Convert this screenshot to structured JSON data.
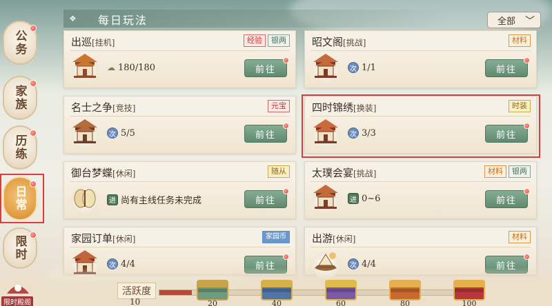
{
  "header": {
    "title": "每日玩法",
    "filter_label": "全部"
  },
  "nav": [
    {
      "label": "公务"
    },
    {
      "label": "家族"
    },
    {
      "label": "历练"
    },
    {
      "label": "日常"
    },
    {
      "label": "限时"
    }
  ],
  "mascot_label": "限时殿阁",
  "cards": [
    {
      "name": "出巡",
      "sub": "[挂机]",
      "tags": [
        "经验",
        "银两"
      ],
      "badge": "☁",
      "value": "180/180",
      "button": "前往"
    },
    {
      "name": "昭文阁",
      "sub": "[挑战]",
      "tags": [
        "材料"
      ],
      "badge": "次",
      "value": "1/1",
      "button": "前往"
    },
    {
      "name": "名士之争",
      "sub": "[竞技]",
      "tags": [
        "元宝"
      ],
      "badge": "次",
      "value": "5/5",
      "button": "前往"
    },
    {
      "name": "四时锦绣",
      "sub": "[换装]",
      "tags": [
        "时装"
      ],
      "badge": "次",
      "value": "3/3",
      "button": "前往"
    },
    {
      "name": "御台梦蝶",
      "sub": "[休闲]",
      "tags": [
        "随从"
      ],
      "badge": "进",
      "value": "尚有主线任务未完成",
      "button": "前往"
    },
    {
      "name": "太璞会宴",
      "sub": "[挑战]",
      "tags": [
        "材料",
        "银两"
      ],
      "badge": "进",
      "value": "0~6",
      "button": "前往"
    },
    {
      "name": "家园订单",
      "sub": "[休闲]",
      "tags": [
        "家园币"
      ],
      "badge": "次",
      "value": "4/4",
      "button": "前往"
    },
    {
      "name": "出游",
      "sub": "[休闲]",
      "tags": [
        "材料"
      ],
      "badge": "次",
      "value": "4/4",
      "button": "前往"
    }
  ],
  "activity": {
    "label": "活跃度",
    "value": "10",
    "progress": 0.1,
    "chests": [
      "20",
      "40",
      "60",
      "80",
      "100"
    ]
  }
}
